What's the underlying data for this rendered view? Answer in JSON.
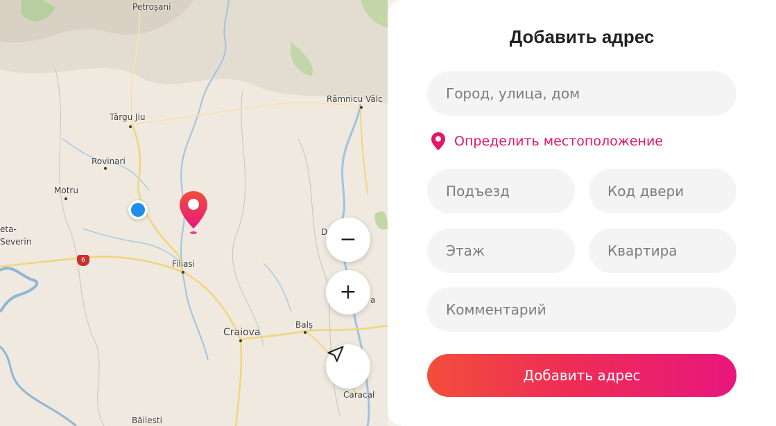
{
  "map": {
    "cities": [
      {
        "name": "Petroșani"
      },
      {
        "name": "Râmnicu Vâlc"
      },
      {
        "name": "Târgu Jiu"
      },
      {
        "name": "Rovinari"
      },
      {
        "name": "Motru"
      },
      {
        "name": "Filiasi"
      },
      {
        "name": "Craiova"
      },
      {
        "name": "Balș"
      },
      {
        "name": "Caracal"
      },
      {
        "name": "Băilesti"
      },
      {
        "name": "eta-"
      },
      {
        "name": "Severin"
      },
      {
        "name": "D"
      },
      {
        "name": "a"
      }
    ],
    "road_badge": "6",
    "controls": {
      "zoom_out": "−",
      "zoom_in": "+"
    }
  },
  "panel": {
    "title": "Добавить адрес",
    "address_placeholder": "Город, улица, дом",
    "locate_label": "Определить местоположение",
    "entrance_placeholder": "Подъезд",
    "door_code_placeholder": "Код двери",
    "floor_placeholder": "Этаж",
    "apartment_placeholder": "Квартира",
    "comment_placeholder": "Комментарий",
    "submit_label": "Добавить адрес"
  },
  "colors": {
    "accent": "#e4166a",
    "gradient_start": "#f24e3c",
    "gradient_end": "#e8177d",
    "user_dot": "#1e8fea"
  }
}
